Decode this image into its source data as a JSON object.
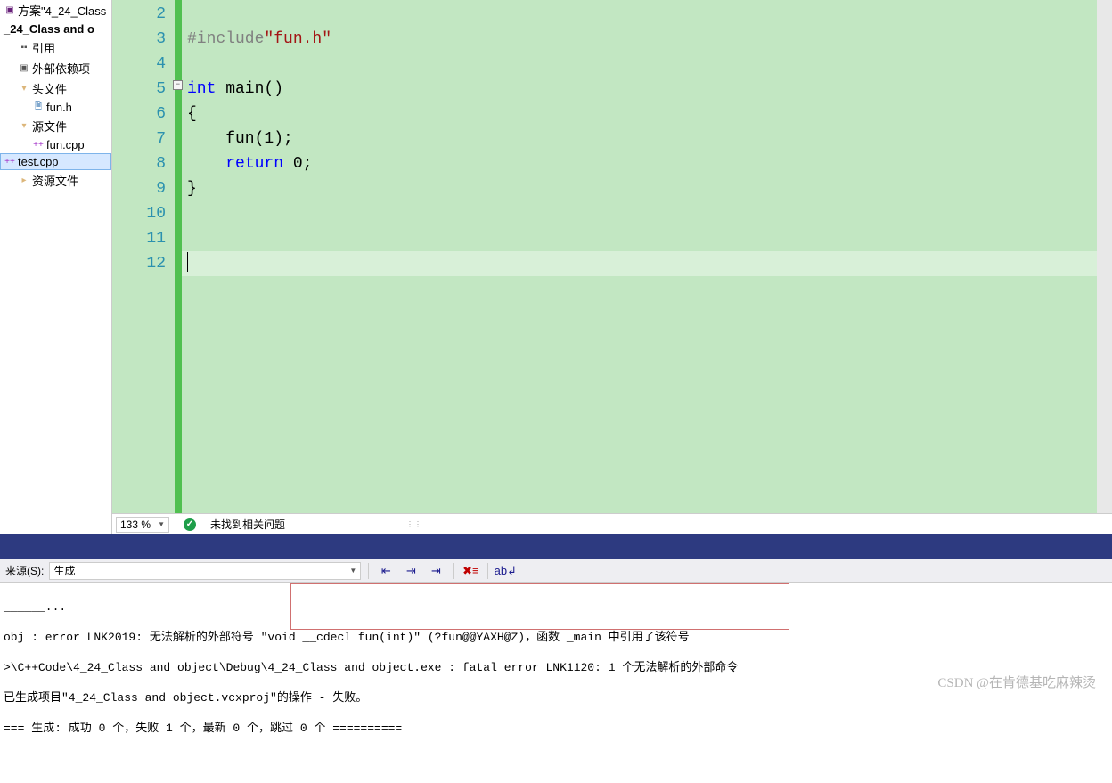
{
  "sidebar": {
    "solution": "方案\"4_24_Class",
    "project": "_24_Class and o",
    "refs": "引用",
    "ext_deps": "外部依赖项",
    "headers": "头文件",
    "header_file": "fun.h",
    "sources": "源文件",
    "src1": "fun.cpp",
    "src2": "test.cpp",
    "resources": "资源文件"
  },
  "code": {
    "lines": [
      "2",
      "3",
      "4",
      "5",
      "6",
      "7",
      "8",
      "9",
      "10",
      "11",
      "12"
    ],
    "l3_pre": "#include",
    "l3_str": "\"fun.h\"",
    "l5a": "int",
    "l5b": " main()",
    "l6": "{",
    "l7": "    fun(1);",
    "l8a": "    ",
    "l8b": "return",
    "l8c": " 0;",
    "l9": "}"
  },
  "status": {
    "zoom": "133 %",
    "issues": "未找到相关问题"
  },
  "output": {
    "source_label": "来源(S):",
    "combo_value": "生成",
    "line0": "...",
    "line1": "obj : error LNK2019: 无法解析的外部符号 \"void __cdecl fun(int)\" (?fun@@YAXH@Z)，函数 _main 中引用了该符号",
    "line2": ">\\C++Code\\4_24_Class and object\\Debug\\4_24_Class and object.exe : fatal error LNK1120: 1 个无法解析的外部命令",
    "line3": "已生成项目\"4_24_Class and object.vcxproj\"的操作 - 失败。",
    "line4": "=== 生成: 成功 0 个，失败 1 个，最新 0 个，跳过 0 个 =========="
  },
  "watermark": "CSDN @在肯德基吃麻辣烫"
}
